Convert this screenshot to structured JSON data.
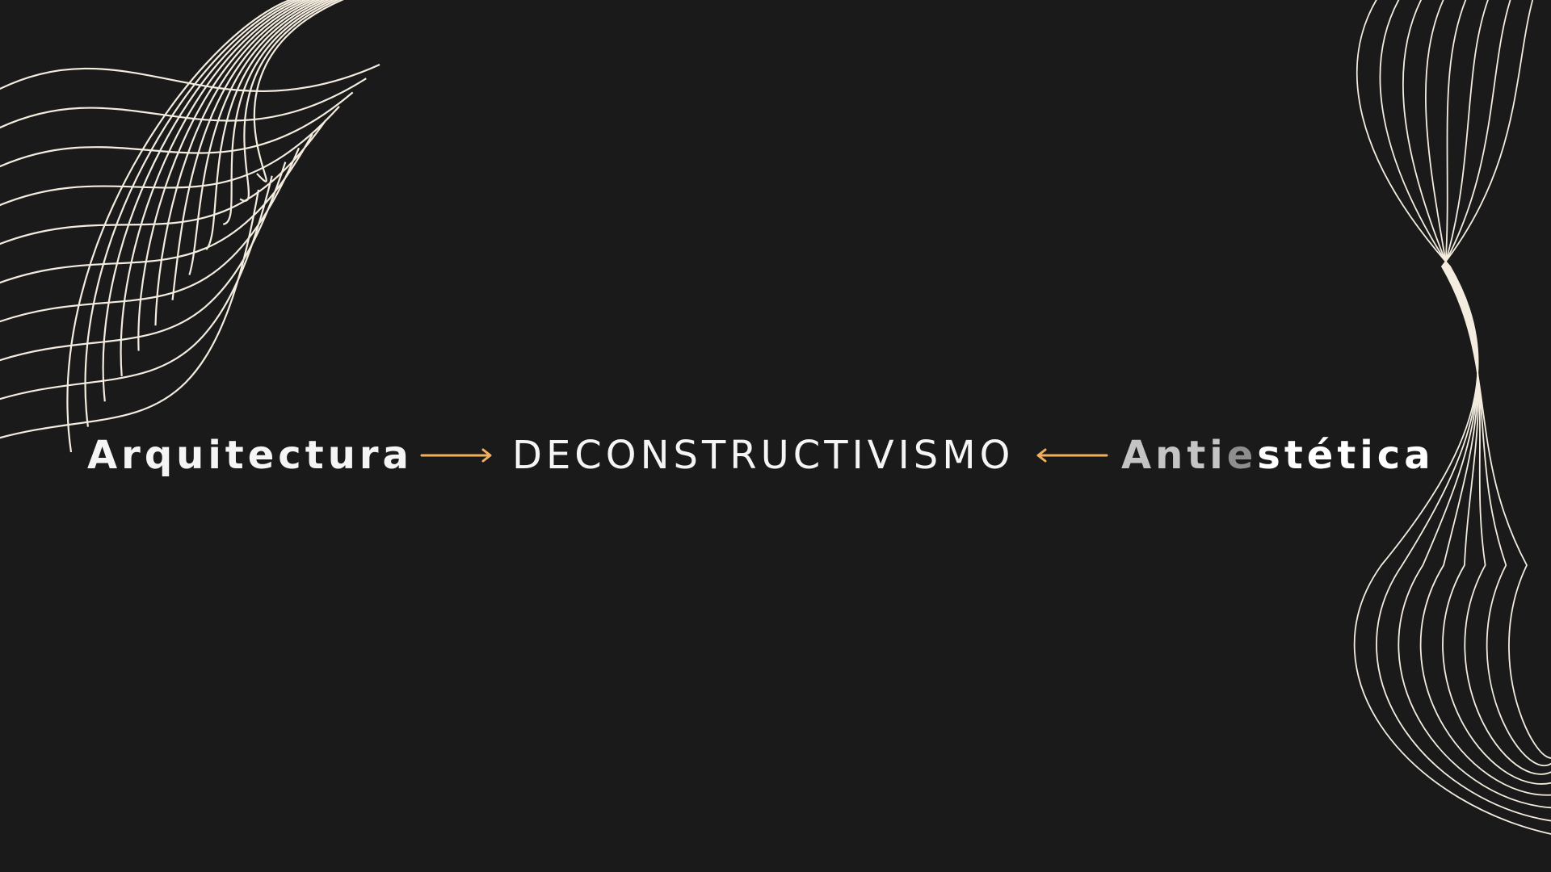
{
  "slide": {
    "left_term": "Arquitectura",
    "center_term": "DECONSTRUCTIVISMO",
    "right_term_prefix": "Anti",
    "right_term_middle": "e",
    "right_term_suffix": "stética"
  },
  "colors": {
    "background": "#1a1a1a",
    "text": "#f5f5f5",
    "arrow": "#f0b060",
    "line_art": "#f3ecdf",
    "right_term_gradient_start": "#bdbdbd",
    "right_term_gradient_end": "#ffffff"
  },
  "icons": {
    "left_arrow": "arrow-right-icon",
    "right_arrow": "arrow-left-icon"
  }
}
